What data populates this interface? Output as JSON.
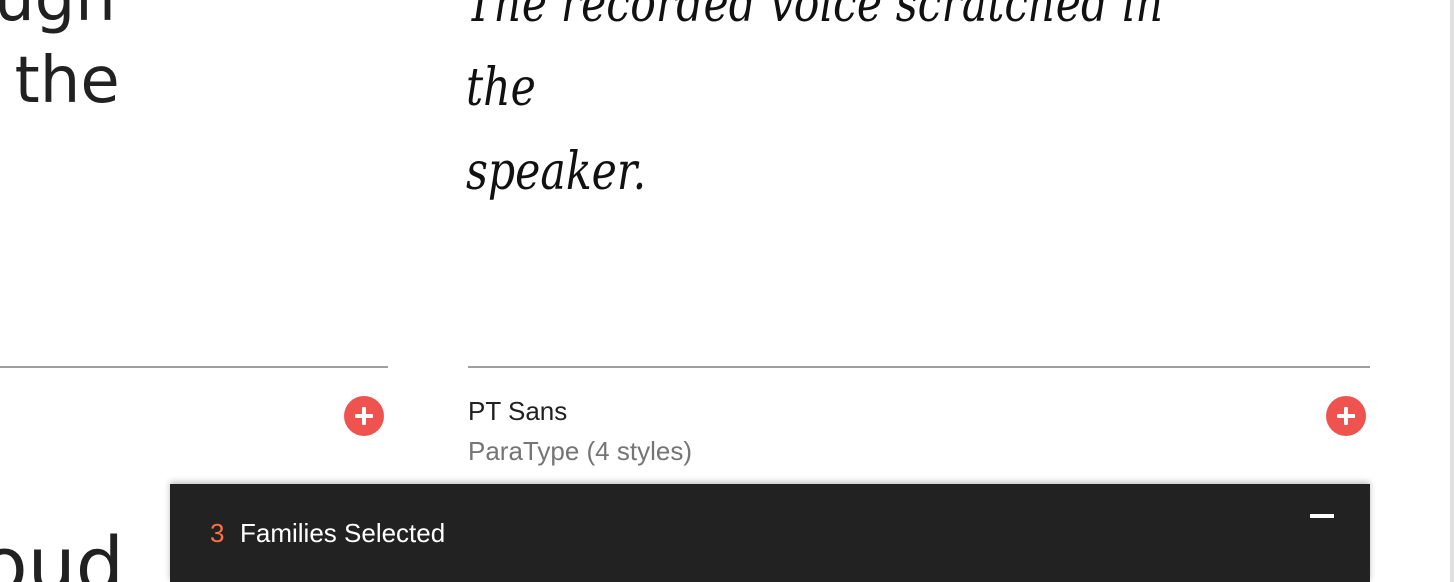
{
  "left_card": {
    "preview_text": "rough\nat the",
    "bottom_preview_fragment": "loud"
  },
  "right_card": {
    "preview_text": "The recorded voice scratched in the\nspeaker.",
    "font_name": "PT Sans",
    "font_meta": "ParaType (4 styles)"
  },
  "selection_drawer": {
    "count": "3",
    "label": "Families Selected"
  },
  "colors": {
    "accent_add": "#ef5350",
    "drawer_background": "#222222",
    "count_accent": "#ff7043"
  },
  "icons": {
    "add": "plus-circle-icon",
    "collapse": "minus-icon"
  }
}
